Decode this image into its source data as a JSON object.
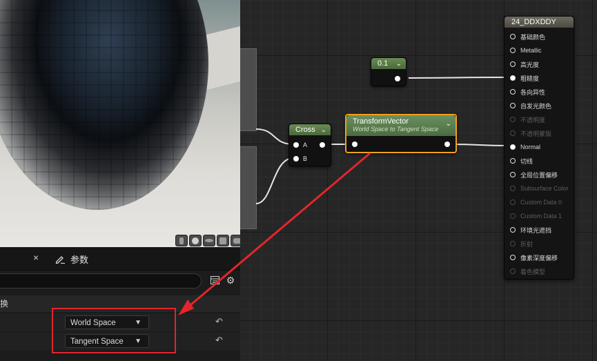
{
  "panel": {
    "tab_close_symbol": "×",
    "params_tab_label": "参数",
    "category_label": "变换",
    "source_space": "World Space",
    "destination_space": "Tangent Space"
  },
  "nodes": {
    "constant": {
      "title": "0.1"
    },
    "cross": {
      "title": "Cross",
      "input_a": "A",
      "input_b": "B"
    },
    "transform": {
      "title": "TransformVector",
      "subtitle": "World Space to Tangent Space"
    }
  },
  "result_node": {
    "title": "24_DDXDDY",
    "pins": [
      "基础颜色",
      "Metallic",
      "高光度",
      "粗糙度",
      "各向异性",
      "自发光颜色",
      "不透明度",
      "不透明蒙版",
      "Normal",
      "切线",
      "全局位置偏移",
      "Subsurface Color",
      "Custom Data 0",
      "Custom Data 1",
      "环境光遮挡",
      "折射",
      "像素深度偏移",
      "着色模型"
    ]
  },
  "colors": {
    "highlight_red": "#e2262b",
    "selected_node_border": "#f0a020",
    "graph_background": "#262626"
  },
  "icons": {
    "params": "pencil-icon",
    "grid": "table-icon",
    "settings": "gear-icon",
    "reset": "reset-arrow-icon",
    "dropdown": "chevron-down-icon"
  }
}
